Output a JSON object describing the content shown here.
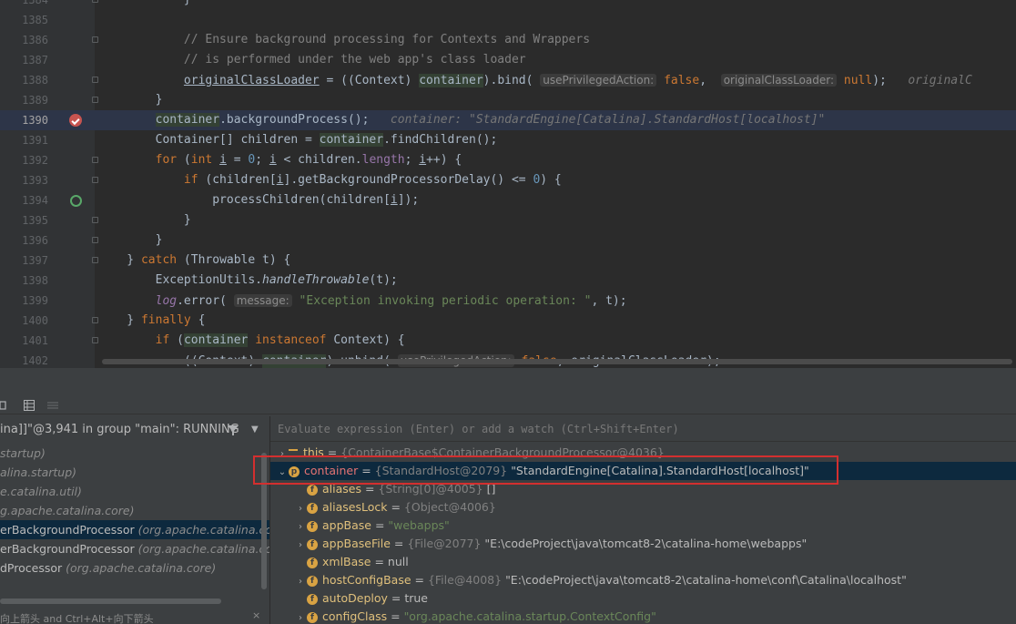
{
  "editor": {
    "lines": [
      {
        "n": "1384",
        "html": "            }"
      },
      {
        "n": "1385",
        "html": ""
      },
      {
        "n": "1386",
        "html": "            <span class=\"cm\">// Ensure background processing for Contexts and Wrappers</span>"
      },
      {
        "n": "1387",
        "html": "            <span class=\"cm\">// is performed under the web app's class loader</span>"
      },
      {
        "n": "1388",
        "html": "            <span class=\"uline\">originalClassLoader</span> = ((Context) <span class=\"hl\">container</span>).bind( <span class=\"hint\">usePrivilegedAction:</span> <span class=\"kw\">false</span>,  <span class=\"hint\">originalClassLoader:</span> <span class=\"kw\">null</span>);   <span class=\"dbg-inline\">originalC</span>"
      },
      {
        "n": "1389",
        "html": "        }"
      },
      {
        "n": "1390",
        "html": "        <span class=\"hl\">container</span>.backgroundProcess();   <span class=\"dbg-inline\">container: \"StandardEngine[Catalina].StandardHost[localhost]\"</span>"
      },
      {
        "n": "1391",
        "html": "        Container[] children = <span class=\"hl\">container</span>.findChildren();"
      },
      {
        "n": "1392",
        "html": "        <span class=\"kw\">for</span> (<span class=\"kw\">int</span> <span class=\"uline\">i</span> = <span class=\"num\">0</span>; <span class=\"uline\">i</span> &lt; children.<span class=\"fld\">length</span>; <span class=\"uline\">i</span>++) {"
      },
      {
        "n": "1393",
        "html": "            <span class=\"kw\">if</span> (children[<span class=\"uline\">i</span>].getBackgroundProcessorDelay() &lt;= <span class=\"num\">0</span>) {"
      },
      {
        "n": "1394",
        "html": "                processChildren(children[<span class=\"uline\">i</span>]);"
      },
      {
        "n": "1395",
        "html": "            }"
      },
      {
        "n": "1396",
        "html": "        }"
      },
      {
        "n": "1397",
        "html": "    } <span class=\"kw\">catch</span> (Throwable t) {"
      },
      {
        "n": "1398",
        "html": "        ExceptionUtils.<span class=\"it\">handleThrowable</span>(t);"
      },
      {
        "n": "1399",
        "html": "        <span class=\"fld it\">log</span>.error( <span class=\"hint\">message:</span> <span class=\"str\">\"Exception invoking periodic operation: \"</span>, t);"
      },
      {
        "n": "1400",
        "html": "    } <span class=\"kw\">finally</span> {"
      },
      {
        "n": "1401",
        "html": "        <span class=\"kw\">if</span> (<span class=\"hl\">container</span> <span class=\"kw\">instanceof</span> Context) {"
      },
      {
        "n": "1402",
        "html": "            ((Context) <span class=\"hl\">container</span>).unbind( <span class=\"hint\">usePrivilegedAction:</span> <span class=\"kw\">false</span>, originalClassLoader);"
      }
    ]
  },
  "debugger": {
    "thread": "ina]]\"@3,941 in group \"main\": RUNNING",
    "frames": [
      {
        "name": "",
        "pkg": "startup)"
      },
      {
        "name": "",
        "pkg": "alina.startup)"
      },
      {
        "name": "",
        "pkg": "e.catalina.util)"
      },
      {
        "name": "",
        "pkg": "g.apache.catalina.core)"
      },
      {
        "name": "erBackgroundProcessor",
        "pkg": "(org.apache.catalina.core)"
      },
      {
        "name": "erBackgroundProcessor",
        "pkg": "(org.apache.catalina.core)"
      },
      {
        "name": "dProcessor",
        "pkg": "(org.apache.catalina.core)"
      }
    ],
    "tip": "向上箭头 and Ctrl+Alt+向下箭头",
    "tip_close": "×",
    "eval_placeholder": "Evaluate expression (Enter) or add a watch (Ctrl+Shift+Enter)",
    "vars": [
      {
        "name": "this",
        "val": "{ContainerBase$ContainerBackgroundProcessor@4036}",
        "str": "",
        "type": "lines"
      },
      {
        "name": "container",
        "val": "{StandardHost@2079}",
        "str": "\"StandardEngine[Catalina].StandardHost[localhost]\"",
        "type": "p"
      },
      {
        "name": "aliases",
        "val": "{String[0]@4005}",
        "str": "[]",
        "type": "f"
      },
      {
        "name": "aliasesLock",
        "val": "{Object@4006}",
        "str": "",
        "type": "f"
      },
      {
        "name": "appBase",
        "val": "",
        "str": "\"webapps\"",
        "type": "f"
      },
      {
        "name": "appBaseFile",
        "val": "{File@2077}",
        "str": "\"E:\\codeProject\\java\\tomcat8-2\\catalina-home\\webapps\"",
        "type": "f"
      },
      {
        "name": "xmlBase",
        "val": "",
        "str": "null",
        "type": "f"
      },
      {
        "name": "hostConfigBase",
        "val": "{File@4008}",
        "str": "\"E:\\codeProject\\java\\tomcat8-2\\catalina-home\\conf\\Catalina\\localhost\"",
        "type": "f"
      },
      {
        "name": "autoDeploy",
        "val": "",
        "str": "true",
        "type": "f"
      },
      {
        "name": "configClass",
        "val": "",
        "str": "\"org.apache.catalina.startup.ContextConfig\"",
        "type": "f"
      }
    ]
  }
}
